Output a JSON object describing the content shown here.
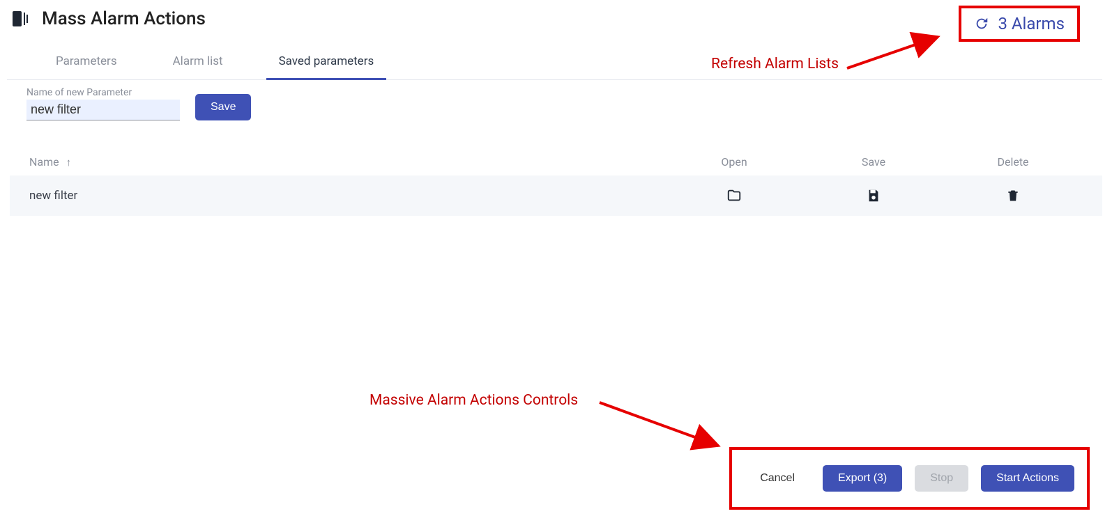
{
  "header": {
    "title": "Mass Alarm Actions"
  },
  "alarms": {
    "text": "3 Alarms"
  },
  "tabs": {
    "parameters": "Parameters",
    "alarm_list": "Alarm list",
    "saved_parameters": "Saved parameters"
  },
  "new_param": {
    "label": "Name of new Parameter",
    "value": "new filter",
    "save_label": "Save"
  },
  "table": {
    "columns": {
      "name": "Name",
      "open": "Open",
      "save": "Save",
      "delete": "Delete"
    },
    "rows": [
      {
        "name": "new filter"
      }
    ]
  },
  "footer": {
    "cancel": "Cancel",
    "export": "Export (3)",
    "stop": "Stop",
    "start": "Start Actions"
  },
  "annotations": {
    "refresh": "Refresh Alarm Lists",
    "controls": "Massive Alarm Actions Controls"
  }
}
